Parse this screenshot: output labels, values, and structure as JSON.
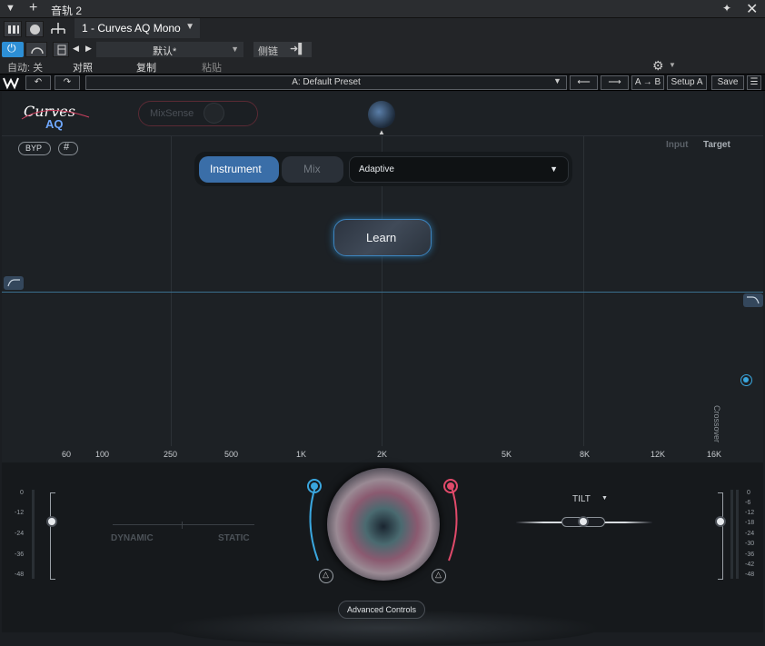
{
  "host": {
    "track_name": "音轨 2",
    "plugin_selector": "1 - Curves AQ Mono",
    "preset_default": "默认*",
    "sidechain_label": "侧链",
    "auto_label": "自动: 关",
    "compare_label": "对照",
    "copy_label": "复制",
    "paste_label": "粘贴"
  },
  "waves_bar": {
    "preset_name": "A: Default Preset",
    "ab_label": "A → B",
    "setup_label": "Setup A",
    "save_label": "Save"
  },
  "plugin": {
    "logo_top": "Curves",
    "logo_bottom": "AQ",
    "mixsense_label": "MixSense",
    "byp_label": "BYP",
    "input_label": "Input",
    "target_label": "Target",
    "mode_instrument": "Instrument",
    "mode_mix": "Mix",
    "dropdown_value": "Adaptive",
    "learn_label": "Learn",
    "crossover_label": "Crossover",
    "freq_labels": [
      "60",
      "100",
      "250",
      "500",
      "1K",
      "2K",
      "5K",
      "8K",
      "12K",
      "16K"
    ],
    "db_labels": [
      "0",
      "-6",
      "-12",
      "-18",
      "-24",
      "-30",
      "-36",
      "-42",
      "-48"
    ],
    "dynamic_label": "DYNAMIC",
    "static_label": "STATIC",
    "tilt_label": "TILT",
    "advanced_label": "Advanced Controls"
  }
}
